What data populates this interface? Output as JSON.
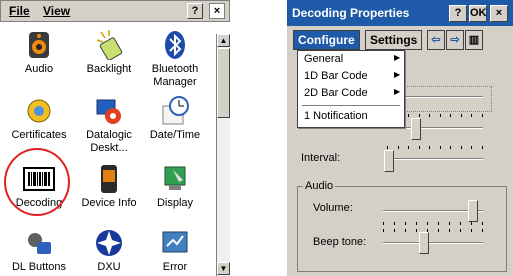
{
  "left": {
    "menu": {
      "file": "File",
      "view": "View"
    },
    "buttons": {
      "help": "?",
      "close": "×"
    },
    "apps": [
      {
        "name": "Audio",
        "icon": "speaker-icon"
      },
      {
        "name": "Backlight",
        "icon": "lamp-icon"
      },
      {
        "name": "Bluetooth Manager",
        "line1": "Bluetooth",
        "line2": "Manager",
        "icon": "bluetooth-icon"
      },
      {
        "name": "Certificates",
        "icon": "certificate-icon"
      },
      {
        "name": "Datalogic Deskt...",
        "line1": "Datalogic",
        "line2": "Deskt...",
        "icon": "datalogic-icon"
      },
      {
        "name": "Date/Time",
        "icon": "clock-icon"
      },
      {
        "name": "Decoding",
        "icon": "barcode-icon"
      },
      {
        "name": "Device Info",
        "icon": "device-icon"
      },
      {
        "name": "Display",
        "icon": "display-icon"
      },
      {
        "name": "DL Buttons",
        "icon": "buttons-icon"
      },
      {
        "name": "DXU",
        "icon": "dxu-icon"
      },
      {
        "name": "Error",
        "icon": "error-icon"
      }
    ],
    "scroll": {
      "up": "▲",
      "down": "▼"
    }
  },
  "right": {
    "title": "Decoding Properties",
    "title_buttons": {
      "help": "?",
      "ok": "OK",
      "close": "×"
    },
    "tabs": {
      "configure": "Configure",
      "settings": "Settings"
    },
    "nav": {
      "left": "⇦",
      "right": "⇨",
      "keyboard": "▥"
    },
    "dropdown": [
      {
        "label": "General",
        "has_submenu": true
      },
      {
        "label": "1D Bar Code",
        "has_submenu": true
      },
      {
        "label": "2D Bar Code",
        "has_submenu": true
      },
      {
        "label": "1 Notification",
        "has_submenu": false
      }
    ],
    "interval_label": "Interval:",
    "audio_group": "Audio",
    "volume_label": "Volume:",
    "beep_label": "Beep tone:",
    "sliders": {
      "top": 0.05,
      "second": 0.25,
      "interval": 0.03,
      "volume": 0.95,
      "beep": 0.45
    }
  }
}
